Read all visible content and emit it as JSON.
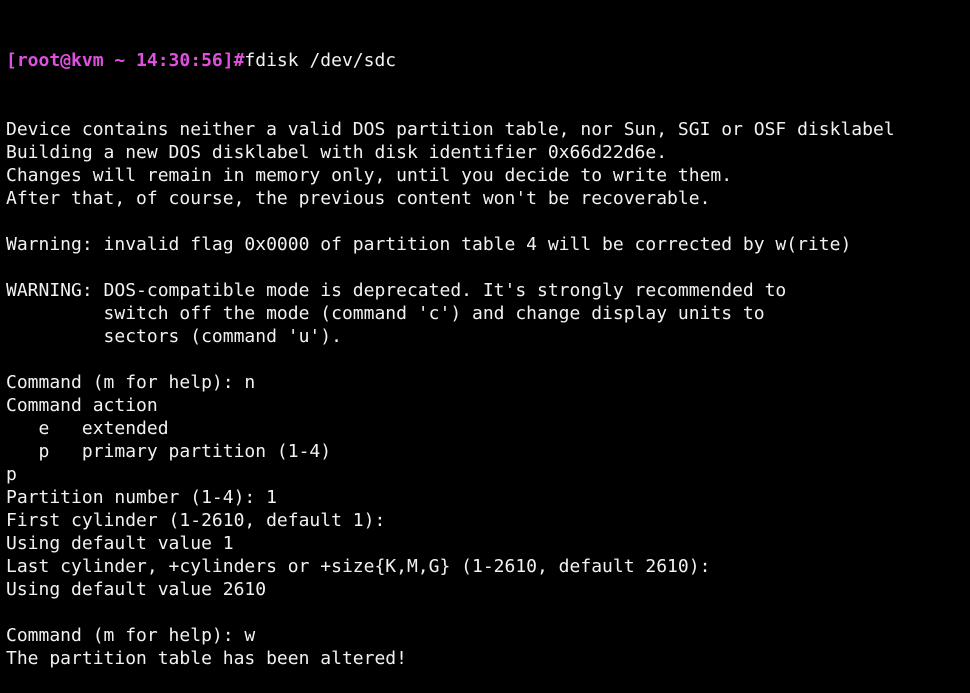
{
  "terminal": {
    "prompt": "[root@kvm ~ 14:30:56]#",
    "command": "fdisk /dev/sdc",
    "prompt_color": "#e050e0",
    "lines": [
      "Device contains neither a valid DOS partition table, nor Sun, SGI or OSF disklabel",
      "Building a new DOS disklabel with disk identifier 0x66d22d6e.",
      "Changes will remain in memory only, until you decide to write them.",
      "After that, of course, the previous content won't be recoverable.",
      "",
      "Warning: invalid flag 0x0000 of partition table 4 will be corrected by w(rite)",
      "",
      "WARNING: DOS-compatible mode is deprecated. It's strongly recommended to",
      "         switch off the mode (command 'c') and change display units to",
      "         sectors (command 'u').",
      "",
      "Command (m for help): n",
      "Command action",
      "   e   extended",
      "   p   primary partition (1-4)",
      "p",
      "Partition number (1-4): 1",
      "First cylinder (1-2610, default 1):",
      "Using default value 1",
      "Last cylinder, +cylinders or +size{K,M,G} (1-2610, default 2610):",
      "Using default value 2610",
      "",
      "Command (m for help): w",
      "The partition table has been altered!"
    ]
  }
}
